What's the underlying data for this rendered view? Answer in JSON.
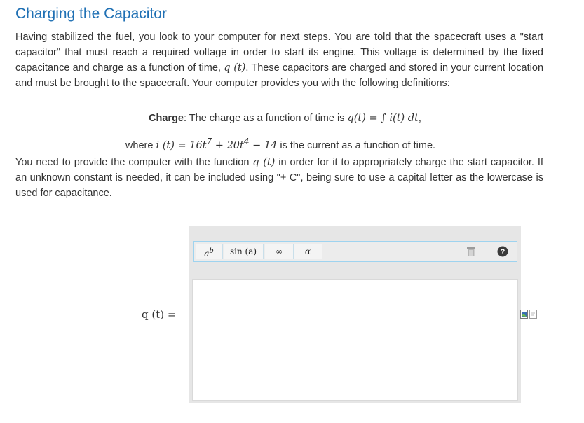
{
  "page": {
    "title": "Charging the Capacitor",
    "intro": {
      "t1": "Having stabilized the fuel, you look to your computer for next steps. You are told that the spacecraft uses a \"start capacitor\" that must reach a required voltage in order to start its engine. This voltage is determined by the fixed capacitance and charge as a function of time, ",
      "m1": "q",
      "m2": "(t)",
      "t2": ". These capacitors are charged and stored in your current location and must be brought to the spacecraft. Your computer provides you with the following definitions:"
    },
    "definition": {
      "label": "Charge",
      "text": ": The charge as a function of time is ",
      "formula": "q(t) = ∫ i(t) dt",
      "end": ","
    },
    "current": {
      "pre": "where ",
      "lhs": "i (t) = 16t",
      "e1": "7",
      "mid": " + 20t",
      "e2": "4",
      "tail": " − 14",
      "post": " is the current as a function of time."
    },
    "instructions": {
      "t1": "You need to provide the computer with the function ",
      "m": "q (t)",
      "t2": " in order for it to appropriately charge the start capacitor. If an unknown constant is needed, it can be included using \"+ C\", being sure to use a capital letter as the lowercase is used for capacitance."
    }
  },
  "answer_label": "q (t)  =",
  "toolbar": {
    "superscript": "a",
    "superscript_sup": "b",
    "sin": "sin (a)",
    "infinity": "∞",
    "alpha": "α",
    "trash_icon": "trash-icon",
    "help_icon": "question-circle-icon",
    "help_glyph": "?"
  },
  "side_icons": [
    "image-icon",
    "document-icon"
  ],
  "colors": {
    "title": "#1f70b4",
    "toolbar_border": "#9ed3ef",
    "help_bg": "#3a3a3a"
  }
}
